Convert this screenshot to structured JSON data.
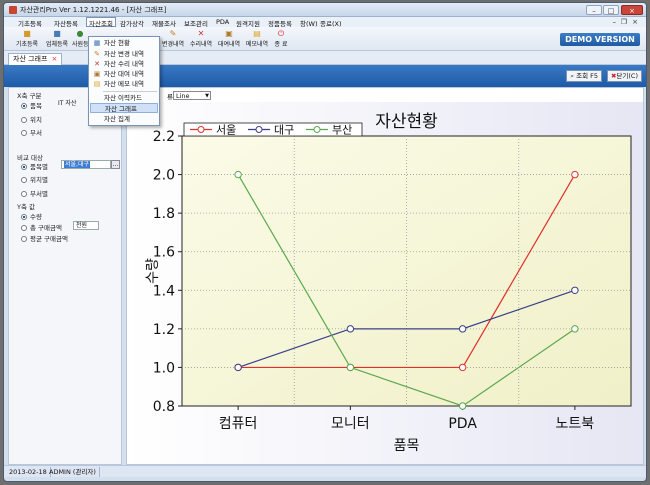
{
  "window": {
    "title": "자산관리Pro Ver 1.12.1221.46 - [자산 그래프]",
    "minimize_glyph": "–",
    "maximize_glyph": "□",
    "close_glyph": "×"
  },
  "menubar": {
    "items": [
      {
        "label": "기초등록"
      },
      {
        "label": "자산등록"
      },
      {
        "label": "자산조회"
      },
      {
        "label": "감가상각"
      },
      {
        "label": "재물조사"
      },
      {
        "label": "보조관리"
      },
      {
        "label": "PDA"
      },
      {
        "label": "원격지원"
      },
      {
        "label": "정품등록"
      },
      {
        "label": "창(W)"
      },
      {
        "label": "종료(X)"
      }
    ],
    "mdi_minimize": "–",
    "mdi_restore": "❐",
    "mdi_close": "×"
  },
  "toolbar": {
    "items": [
      {
        "label": "기초등록",
        "icon": "folder-icon"
      },
      {
        "label": "업체등록",
        "icon": "building-icon"
      },
      {
        "label": "사원등",
        "icon": "person-icon"
      },
      {
        "label": "변경내역",
        "icon": "edit-icon"
      },
      {
        "label": "수리내역",
        "icon": "wrench-icon"
      },
      {
        "label": "대여내역",
        "icon": "box-icon"
      },
      {
        "label": "메모내역",
        "icon": "memo-icon"
      },
      {
        "label": "종 료",
        "icon": "power-icon"
      }
    ],
    "demo_label": "DEMO VERSION"
  },
  "tabs": {
    "doc_tab_label": "자산 그래프",
    "doc_tab_close": "×"
  },
  "strip": {
    "search_label": "조회 F5",
    "close_label": "닫기(C)"
  },
  "left_panel": {
    "x_axis_group": "X축 구분",
    "x_options": [
      "품목",
      "위치",
      "부서"
    ],
    "x_field_value": "IT 자산",
    "compare_group": "비교 대상",
    "compare_options": [
      "품목별",
      "위치별",
      "부서별"
    ],
    "compare_field_value": "서울,대구",
    "y_axis_group": "Y축 값",
    "y_options": [
      "수량",
      "총 구매금액",
      "평균 구매금액"
    ],
    "unit_value": "천원"
  },
  "chart_controls": {
    "type_label": "류:",
    "type_value": "Line"
  },
  "dropdown": {
    "items": [
      {
        "label": "자산 현황",
        "icon": "grid-icon"
      },
      {
        "label": "자산 변경 내역",
        "icon": "edit-icon"
      },
      {
        "label": "자산 수리 내역",
        "icon": "wrench-icon"
      },
      {
        "label": "자산 대여 내역",
        "icon": "box-icon"
      },
      {
        "label": "자산 메모 내역",
        "icon": "memo-icon"
      },
      {
        "label": "자산 이력카드",
        "icon": ""
      },
      {
        "label": "자산 그래프",
        "icon": ""
      },
      {
        "label": "자산 집계",
        "icon": ""
      }
    ]
  },
  "status": {
    "date": "2013-02-18",
    "user": "ADMIN (관리자)"
  },
  "chart_data": {
    "type": "line",
    "title": "자산현황",
    "xlabel": "품목",
    "ylabel": "수량",
    "categories": [
      "컴퓨터",
      "모니터",
      "PDA",
      "노트북"
    ],
    "ylim": [
      0.8,
      2.2
    ],
    "yticks": [
      "0.8",
      "1.0",
      "1.2",
      "1.4",
      "1.6",
      "1.8",
      "2.0",
      "2.2"
    ],
    "grid": true,
    "legend": "top-left",
    "series": [
      {
        "name": "서울",
        "color": "#e0302a",
        "values": [
          1.0,
          1.0,
          1.0,
          2.0
        ]
      },
      {
        "name": "대구",
        "color": "#3a3f8a",
        "values": [
          1.0,
          1.2,
          1.2,
          1.4
        ]
      },
      {
        "name": "부산",
        "color": "#5aa84c",
        "values": [
          2.0,
          1.0,
          0.8,
          1.2
        ]
      }
    ]
  }
}
